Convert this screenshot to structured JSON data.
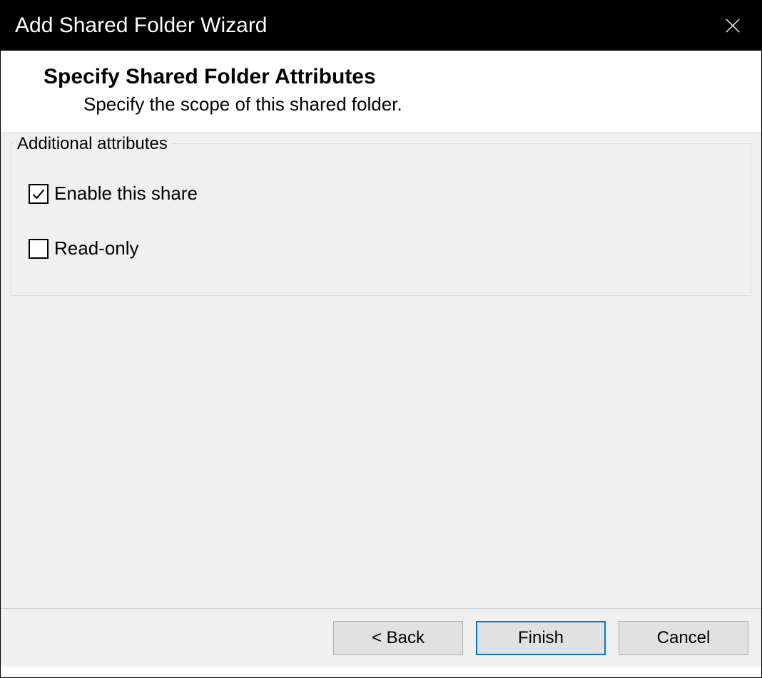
{
  "window": {
    "title": "Add Shared Folder Wizard"
  },
  "header": {
    "heading": "Specify Shared Folder Attributes",
    "subheading": "Specify the scope of this shared folder."
  },
  "content": {
    "groupbox_label": "Additional attributes",
    "options": [
      {
        "label": "Enable this share",
        "checked": true
      },
      {
        "label": "Read-only",
        "checked": false
      }
    ]
  },
  "footer": {
    "back_label": "< Back",
    "finish_label": "Finish",
    "cancel_label": "Cancel"
  }
}
